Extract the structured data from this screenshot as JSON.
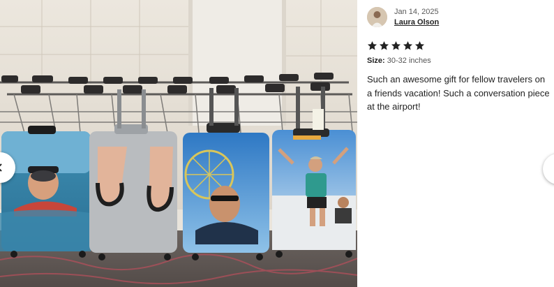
{
  "photo": {
    "alt_subject": "custom-printed-luggage-covers"
  },
  "review": {
    "date": "Jan 14, 2025",
    "author": "Laura Olson",
    "rating": 5,
    "rating_max": 5,
    "size_label": "Size:",
    "size_value": "30-32 inches",
    "text": "Such an awesome gift for fellow travelers on a friends vacation! Such a conversation piece at the airport!"
  },
  "icons": {
    "prev": "chevron-left-icon",
    "next": "chevron-right-icon",
    "star": "star-icon"
  },
  "colors": {
    "star": "#222222",
    "text": "#222222",
    "muted": "#595959"
  }
}
